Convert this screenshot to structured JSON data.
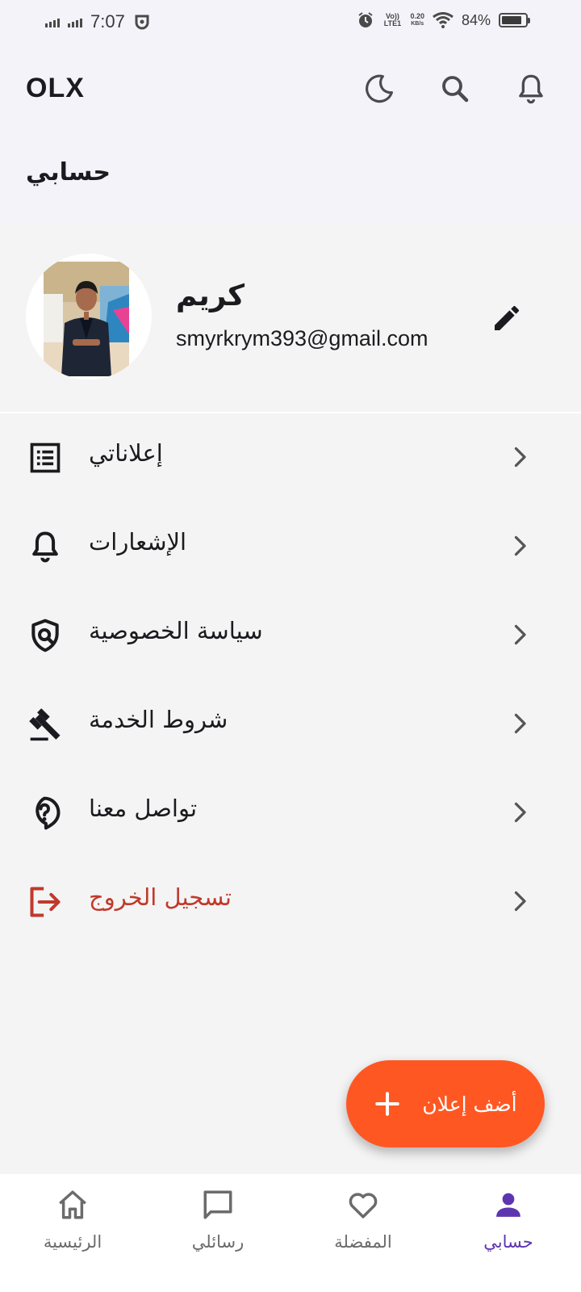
{
  "status_bar": {
    "time": "7:07",
    "volte": "Vo)) LTE1",
    "speed_value": "0.20",
    "speed_unit": "KB/s",
    "battery_percent": "84%",
    "battery_level": 0.84
  },
  "app_bar": {
    "brand": "OLX",
    "icons": [
      "moon-icon",
      "search-icon",
      "bell-icon"
    ]
  },
  "page": {
    "title": "حسابي"
  },
  "profile": {
    "name": "كريم",
    "email": "smyrkrym393@gmail.com",
    "edit_icon": "pencil-icon"
  },
  "menu": {
    "items": [
      {
        "label": "إعلاناتي",
        "icon": "list-icon"
      },
      {
        "label": "الإشعارات",
        "icon": "bell-icon"
      },
      {
        "label": "سياسة الخصوصية",
        "icon": "shield-icon"
      },
      {
        "label": "شروط الخدمة",
        "icon": "gavel-icon"
      },
      {
        "label": "تواصل معنا",
        "icon": "help-icon"
      },
      {
        "label": "تسجيل الخروج",
        "icon": "logout-icon"
      }
    ]
  },
  "fab": {
    "label": "أضف إعلان",
    "icon": "plus-icon"
  },
  "bottom_nav": {
    "items": [
      {
        "label": "الرئيسية",
        "icon": "home-icon"
      },
      {
        "label": "رسائلي",
        "icon": "chat-icon"
      },
      {
        "label": "المفضلة",
        "icon": "heart-icon"
      },
      {
        "label": "حسابي",
        "icon": "person-icon"
      }
    ],
    "active_index": 3
  },
  "colors": {
    "accent": "#ff5722",
    "active_nav": "#5e35b1",
    "logout": "#c0392b",
    "app_bar_bg": "#f4f3f9",
    "body_bg": "#f4f4f4"
  }
}
